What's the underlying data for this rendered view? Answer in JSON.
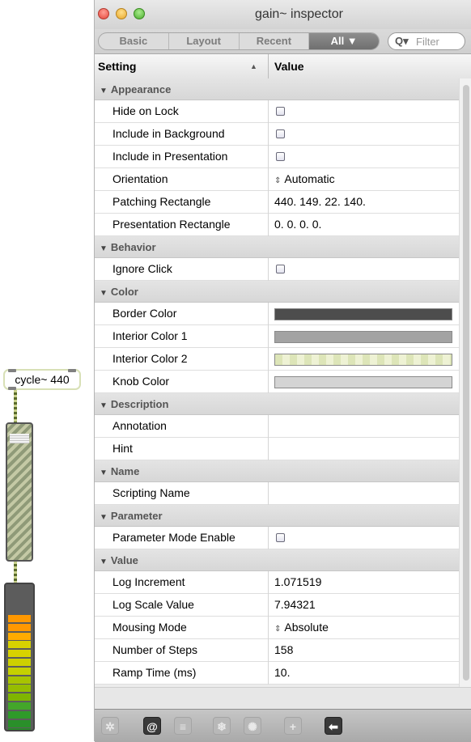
{
  "patch": {
    "cycle_object": "cycle~ 440",
    "meter_colors": [
      "#ff9800",
      "#ff9800",
      "#ffab00",
      "#d8d200",
      "#d8d200",
      "#cdd000",
      "#c5d000",
      "#a8c400",
      "#96bd00",
      "#7fb500",
      "#43a62a",
      "#2f9a2a",
      "#2a8f2a",
      "#278a27",
      "#258025"
    ]
  },
  "window": {
    "title": "gain~ inspector"
  },
  "tabs": {
    "basic": "Basic",
    "layout": "Layout",
    "recent": "Recent",
    "all": "All ▼"
  },
  "filter": {
    "icon": "Q▾",
    "placeholder": "Filter"
  },
  "header": {
    "setting": "Setting",
    "sort_arrow": "▲",
    "value": "Value"
  },
  "categories": {
    "appearance": "Appearance",
    "behavior": "Behavior",
    "color": "Color",
    "description": "Description",
    "name": "Name",
    "parameter": "Parameter",
    "value": "Value"
  },
  "rows": {
    "hide_on_lock": "Hide on Lock",
    "include_background": "Include in Background",
    "include_presentation": "Include in Presentation",
    "orientation": "Orientation",
    "orientation_value": "Automatic",
    "patching_rect": "Patching Rectangle",
    "patching_rect_value": "440. 149. 22. 140.",
    "presentation_rect": "Presentation Rectangle",
    "presentation_rect_value": "0. 0. 0. 0.",
    "ignore_click": "Ignore Click",
    "border_color": "Border Color",
    "interior_color_1": "Interior Color 1",
    "interior_color_2": "Interior Color 2",
    "knob_color": "Knob Color",
    "annotation": "Annotation",
    "hint": "Hint",
    "scripting_name": "Scripting Name",
    "parameter_mode_enable": "Parameter Mode Enable",
    "log_increment": "Log Increment",
    "log_increment_value": "1.071519",
    "log_scale_value": "Log Scale Value",
    "log_scale_value_value": "7.94321",
    "mousing_mode": "Mousing Mode",
    "mousing_mode_value": "Absolute",
    "number_of_steps": "Number of Steps",
    "number_of_steps_value": "158",
    "ramp_time": "Ramp Time (ms)",
    "ramp_time_value": "10."
  },
  "colors": {
    "border_color": "#4d4d4d",
    "interior_color_1": "#a3a3a3",
    "interior_color_2": "#dde5b8",
    "knob_color": "#d4d4d4"
  },
  "toolbar": {
    "gear": "✲",
    "at": "@",
    "list": "≡",
    "snowflake": "❄",
    "flower": "✺",
    "plus": "+",
    "back": "⬅"
  }
}
